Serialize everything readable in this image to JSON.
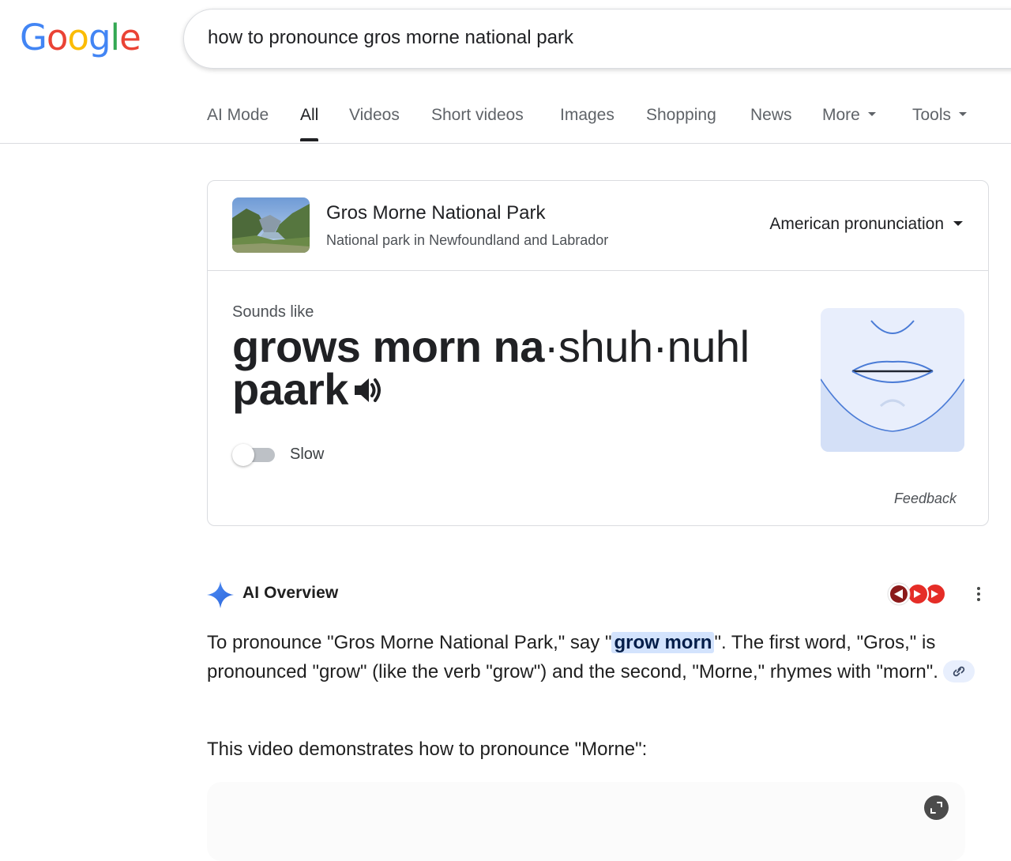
{
  "logo": {
    "letters": [
      "G",
      "o",
      "o",
      "g",
      "l",
      "e"
    ]
  },
  "search": {
    "query": "how to pronounce gros morne national park"
  },
  "tabs": [
    {
      "label": "AI Mode",
      "active": false
    },
    {
      "label": "All",
      "active": true
    },
    {
      "label": "Videos",
      "active": false
    },
    {
      "label": "Short videos",
      "active": false
    },
    {
      "label": "Images",
      "active": false
    },
    {
      "label": "Shopping",
      "active": false
    },
    {
      "label": "News",
      "active": false
    },
    {
      "label": "More",
      "active": false
    },
    {
      "label": "Tools",
      "active": false
    }
  ],
  "pronunciation": {
    "entity_title": "Gros Morne National Park",
    "entity_subtitle": "National park in Newfoundland and Labrador",
    "accent_select": "American pronunciation",
    "sounds_like_label": "Sounds like",
    "phonetic": {
      "bold_part": "grows morn na",
      "light_part_1": "shuh",
      "light_part_2": "nuhl",
      "second_line": "paark",
      "separator": "·"
    },
    "slow_label": "Slow",
    "slow_enabled": false,
    "feedback_label": "Feedback"
  },
  "ai_overview": {
    "title": "AI Overview",
    "para_before": "To pronounce \"Gros Morne National Park,\" say \"",
    "highlight": "grow morn",
    "para_after": "\". The first word, \"Gros,\" is pronounced \"grow\" (like the verb \"grow\") and the second, \"Morne,\" rhymes with \"morn\".",
    "para2": "This video demonstrates how to pronounce \"Morne\":"
  },
  "icons": {
    "gemini_star": "sparkle-icon",
    "speaker": "speaker-icon",
    "link": "link-icon",
    "more": "more-vert-icon",
    "expand": "expand-icon"
  },
  "colors": {
    "google_blue": "#4285F4",
    "google_red": "#EA4335",
    "google_yellow": "#FBBC05",
    "google_green": "#34A853",
    "highlight_bg": "#d3e3fd",
    "youtube_red": "#e52d27"
  }
}
